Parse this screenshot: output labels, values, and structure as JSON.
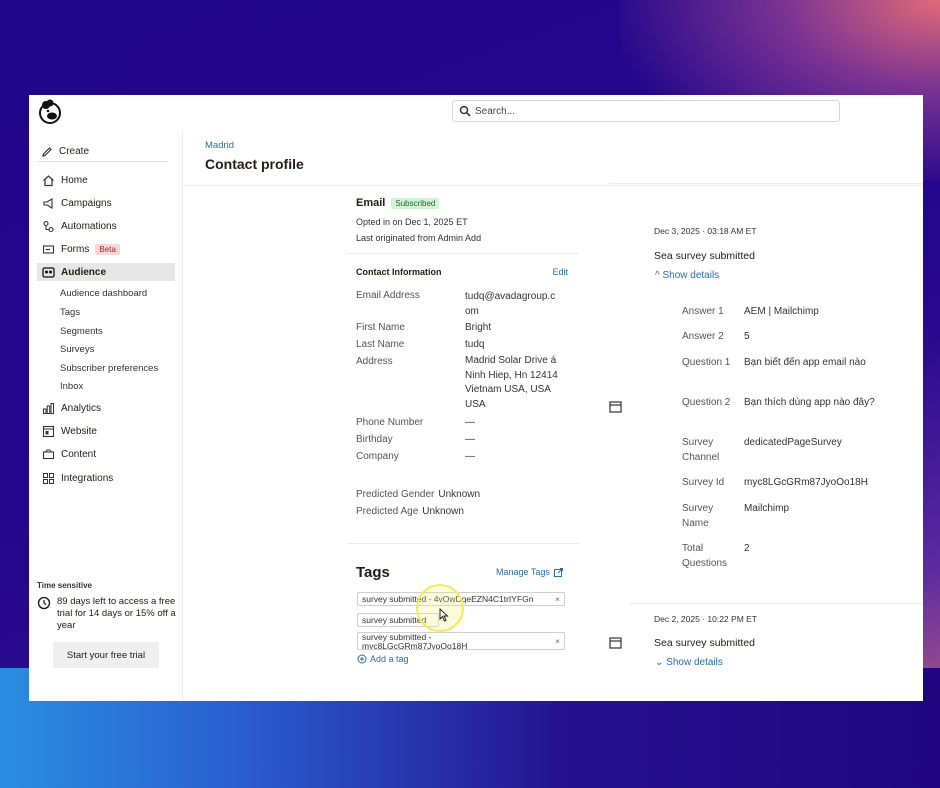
{
  "search": {
    "placeholder": "Search..."
  },
  "sidebar": {
    "create_label": "Create",
    "items": [
      {
        "label": "Home",
        "icon": "home-icon"
      },
      {
        "label": "Campaigns",
        "icon": "megaphone-icon"
      },
      {
        "label": "Automations",
        "icon": "automation-icon"
      },
      {
        "label": "Forms",
        "icon": "form-icon",
        "badge": "Beta"
      },
      {
        "label": "Audience",
        "icon": "audience-icon",
        "active": true
      },
      {
        "label": "Analytics",
        "icon": "bar-chart-icon"
      },
      {
        "label": "Website",
        "icon": "website-icon"
      },
      {
        "label": "Content",
        "icon": "content-icon"
      },
      {
        "label": "Integrations",
        "icon": "grid-icon"
      }
    ],
    "audience_sub": [
      "Audience dashboard",
      "Tags",
      "Segments",
      "Surveys",
      "Subscriber preferences",
      "Inbox"
    ],
    "promo": {
      "tag": "Time sensitive",
      "message": "89 days left to access a free trial for 14 days or 15% off a year",
      "button": "Start your free trial"
    }
  },
  "header": {
    "breadcrumb": "Madrid",
    "title": "Contact profile"
  },
  "contact": {
    "email_heading": "Email",
    "status": "Subscribed",
    "opted_in": "Opted in on Dec 1, 2025 ET",
    "last_originated": "Last originated from Admin Add",
    "info_heading": "Contact Information",
    "edit_label": "Edit",
    "fields": [
      {
        "label": "Email Address",
        "value": "tudq@avadagroup.c\nom"
      },
      {
        "label": "First Name",
        "value": "Bright"
      },
      {
        "label": "Last Name",
        "value": "tudq"
      },
      {
        "label": "Address",
        "value": "Madrid Solar Drive á\nNinh Hiep, Hn 12414\nVietnam USA, USA\nUSA"
      },
      {
        "label": "Phone Number",
        "value": "—"
      },
      {
        "label": "Birthday",
        "value": "—"
      },
      {
        "label": "Company",
        "value": "—"
      }
    ],
    "predicted_gender_label": "Predicted Gender",
    "predicted_gender": "Unknown",
    "predicted_age_label": "Predicted Age",
    "predicted_age": "Unknown"
  },
  "tags": {
    "title": "Tags",
    "manage_label": "Manage Tags",
    "chips": [
      "survey submitted - 4vOwDqeEZN4C1trIYFGn",
      "survey submitted",
      "survey submitted -\nmyc8LGcGRm87JyoOo18H"
    ],
    "add_label": "Add a tag"
  },
  "activity": [
    {
      "date": "Dec 3, 2025 · 03:18 AM ET",
      "title": "Sea survey submitted",
      "toggle": "^ Show details",
      "details": [
        {
          "label": "Answer 1",
          "value": "AEM | Mailchimp"
        },
        {
          "label": "Answer 2",
          "value": "5"
        },
        {
          "label": "Question 1",
          "value": "Bạn biết đến app email nào"
        },
        {
          "label": "Question 2",
          "value": "Bạn thích dùng app nào đây?"
        },
        {
          "label": "Survey Channel",
          "value": "dedicatedPageSurvey"
        },
        {
          "label": "Survey Id",
          "value": "myc8LGcGRm87JyoOo18H"
        },
        {
          "label": "Survey Name",
          "value": "Mailchimp"
        },
        {
          "label": "Total Questions",
          "value": "2"
        }
      ]
    },
    {
      "date": "Dec 2, 2025 · 10:22 PM ET",
      "title": "Sea survey submitted",
      "toggle": "⌄ Show details"
    }
  ]
}
